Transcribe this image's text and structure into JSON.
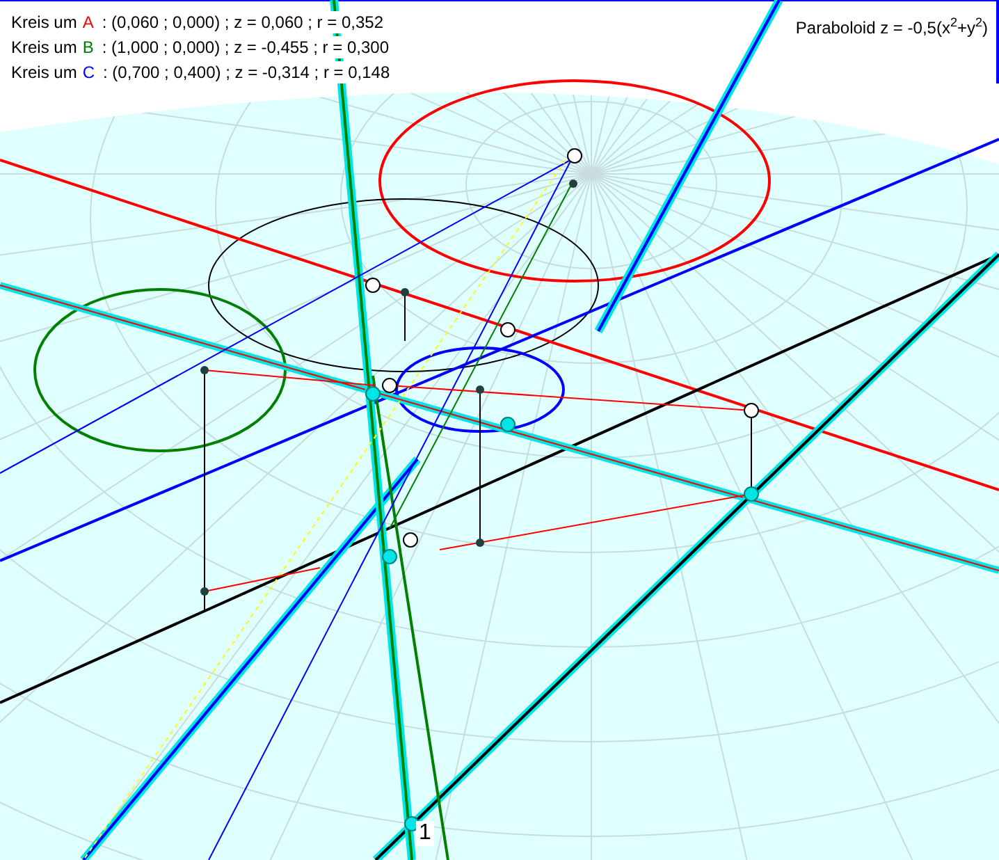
{
  "legend": [
    {
      "label": "Kreis um",
      "point": "A",
      "color": "#ff0000",
      "text": ": (0,060 ; 0,000) ; z = 0,060 ; r = 0,352"
    },
    {
      "label": "Kreis um",
      "point": "B",
      "color": "#008000",
      "text": ": (1,000 ; 0,000) ; z = -0,455 ; r = 0,300"
    },
    {
      "label": "Kreis um",
      "point": "C",
      "color": "#0000ff",
      "text": ": (0,700 ; 0,400) ; z = -0,314 ; r = 0,148"
    }
  ],
  "title": "Paraboloid z = -0,5(x$^{2}$+y$^{2}$)",
  "point_label": "1"
}
